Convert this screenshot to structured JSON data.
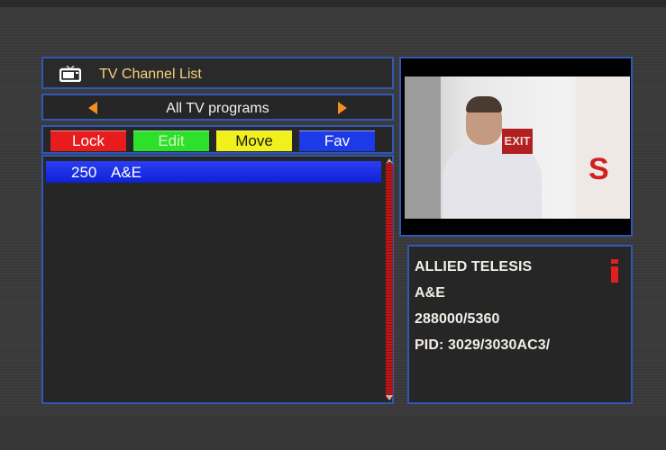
{
  "header": {
    "title": "TV Channel List",
    "icon": "tv-icon"
  },
  "group_nav": {
    "label": "All TV programs",
    "left_icon": "arrow-left-icon",
    "right_icon": "arrow-right-icon",
    "arrow_color": "#f09020"
  },
  "function_keys": [
    {
      "label": "Lock",
      "color": "#e81c1c"
    },
    {
      "label": "Edit",
      "color": "#2ce02c"
    },
    {
      "label": "Move",
      "color": "#f0f01c"
    },
    {
      "label": "Fav",
      "color": "#1c3ae8"
    }
  ],
  "channels": [
    {
      "number": "250",
      "name": "A&E",
      "selected": true
    }
  ],
  "preview": {
    "overlay_sign": "EXIT"
  },
  "info": {
    "provider": "ALLIED TELESIS",
    "channel": "A&E",
    "frequency": "288000/5360",
    "pid": "PID: 3029/3030AC3/",
    "icon": "info-icon"
  },
  "colors": {
    "panel_border": "#2f58b8",
    "title_text": "#f3d27a",
    "selection": "#2a3df2"
  }
}
